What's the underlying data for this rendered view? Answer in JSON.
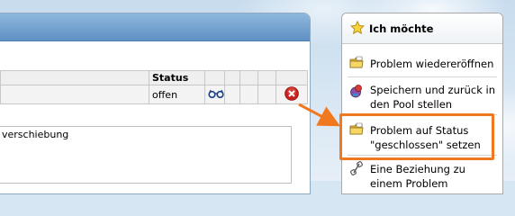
{
  "table": {
    "header_status": "Status",
    "row_status": "offen"
  },
  "lower_panel": {
    "text": "verschiebung"
  },
  "sidebar": {
    "title": "Ich möchte",
    "items": [
      {
        "label": "Problem wiedereröffnen",
        "icon": "folder-icon"
      },
      {
        "label": "Speichern und zurück in den Pool stellen",
        "icon": "save-icon"
      },
      {
        "label": "Problem auf Status \"geschlossen\" setzen",
        "icon": "folder-icon"
      },
      {
        "label": "Eine Beziehung zu einem Problem hinzufügen",
        "icon": "link-icon"
      }
    ]
  },
  "colors": {
    "highlight": "#f0781f",
    "header_blue": "#5f91c4"
  }
}
